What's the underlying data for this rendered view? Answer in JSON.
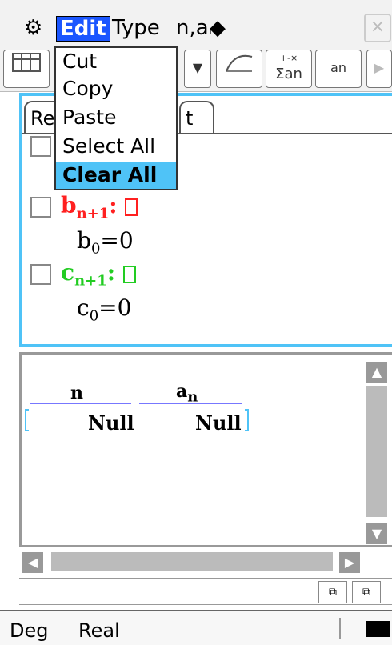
{
  "menubar": {
    "gear_icon": "gear-icon",
    "edit_label": "Edit",
    "type_label": "Type",
    "sequence_label": "n,aₙ",
    "diamond_label": "◆",
    "close_label": "×"
  },
  "toolbar": {
    "sum_label": "Σan",
    "an_label": "an"
  },
  "edit_menu": {
    "items": [
      "Cut",
      "Copy",
      "Paste",
      "Select All",
      "Clear All"
    ],
    "highlighted": "Clear All"
  },
  "editor": {
    "tab1": "Rec",
    "tab2": "t",
    "b_formula": "b",
    "b_sub": "n+1",
    "b_colon": ":",
    "b_init": "b",
    "b_init_sub": "0",
    "b_init_val": "=0",
    "c_formula": "c",
    "c_sub": "n+1",
    "c_colon": ":",
    "c_init": "c",
    "c_init_sub": "0",
    "c_init_val": "=0"
  },
  "table": {
    "headers": [
      "n",
      "a"
    ],
    "a_sub": "n",
    "values": [
      "Null",
      "Null"
    ]
  },
  "statusbar": {
    "angle": "Deg",
    "mode": "Real"
  },
  "colors": {
    "b_color": "#ff2020",
    "c_color": "#22cc22",
    "accent": "#4fc3f7",
    "edit_bg": "#1b56ff"
  }
}
